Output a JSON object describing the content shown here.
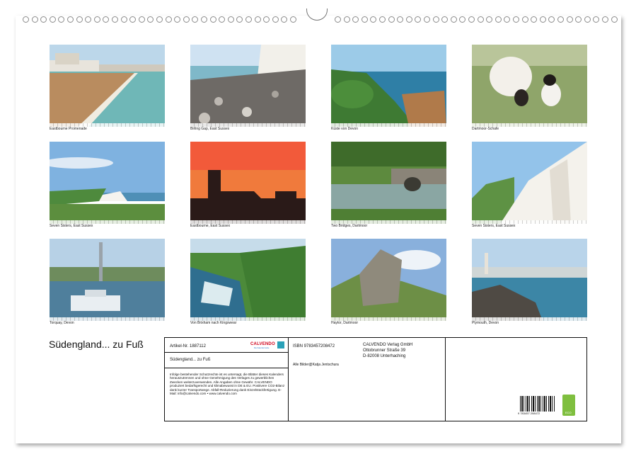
{
  "calendar": {
    "title": "Südengland... zu Fuß",
    "photos": [
      {
        "caption": "Eastbourne Promenade"
      },
      {
        "caption": "Birling Gap, East Sussex"
      },
      {
        "caption": "Küste von Devon"
      },
      {
        "caption": "Dartmoor-Schafe"
      },
      {
        "caption": "Seven Sisters, East Sussex"
      },
      {
        "caption": "Eastbourne, East Sussex"
      },
      {
        "caption": "Two Bridges, Dartmoor"
      },
      {
        "caption": "Seven Sisters, East Sussex"
      },
      {
        "caption": "Torquay, Devon"
      },
      {
        "caption": "Von Brixham nach Kingswear"
      },
      {
        "caption": "Haytor, Dartmoor"
      },
      {
        "caption": "Plymouth, Devon"
      }
    ]
  },
  "info": {
    "article": "Artikel-Nr. 1887112",
    "logo": "CALVENDO",
    "logo_sub": "Die Kalendermarke",
    "product_title": "Südengland... zu Fuß",
    "legal": "Infolge bestehender Schutzrechte ist es untersagt, die Blätter dieses Kalenders herauszutrennen und ohne Genehmigung des Verlages zu gewerblichen Zwecken weiterzuverwenden. Alle Angaben ohne Gewähr. CALVENDO produziert bedarfsgerecht und klimabewusst in DE & EU. Positivere CO2-Bilanz dank kurzer Transportwege. Abfall-Reduzierung dank Einzelstückfertigung. E-Mail: info@calvendo.com • www.calvendo.com",
    "isbn": "ISBN 9783457208472",
    "credits": "Alle Bilder@Katja Jentschura",
    "publisher_name": "CALVENDO Verlag GmbH",
    "publisher_street": "Ottobrunner Straße 39",
    "publisher_city": "D-82008 Unterhaching",
    "barcode_number": "9 783457 208472",
    "eco_label": "ECO"
  }
}
